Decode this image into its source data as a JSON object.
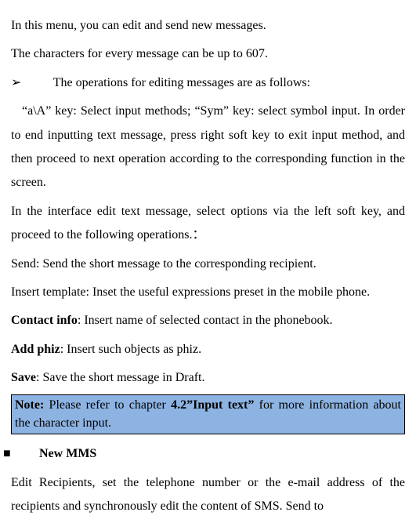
{
  "p1": "In this menu, you can edit and send new messages.",
  "p2": "The characters for every message can be up to 607.",
  "bullet1": "The operations for editing messages are as follows:",
  "p3": "“a\\A” key: Select input methods; “Sym” key: select symbol input. In order to end inputting text message, press right soft key to exit input method, and then proceed to next operation according to the corresponding function in the screen.",
  "p4": "In the interface edit text message, select options via the left soft key, and proceed to the following operations.：",
  "p5": "Send: Send the short message to the corresponding recipient.",
  "p6": "Insert template: Inset the useful expressions preset in the mobile phone.",
  "contact_label": "Contact info",
  "contact_text": ": Insert name of selected contact in the phonebook.",
  "phiz_label": "Add phiz",
  "phiz_text": ": Insert such objects as phiz.",
  "save_label": "Save",
  "save_text": ": Save the short message in Draft.",
  "note_prefix": "Note:",
  "note_mid1": " Please refer to chapter ",
  "note_bold": "4.2”Input text”",
  "note_mid2": " for more information about the character input.",
  "mms_heading": "New MMS",
  "p7": "Edit Recipients, set the telephone number or the e-mail address of the recipients and synchronously edit the content of SMS. Send to"
}
